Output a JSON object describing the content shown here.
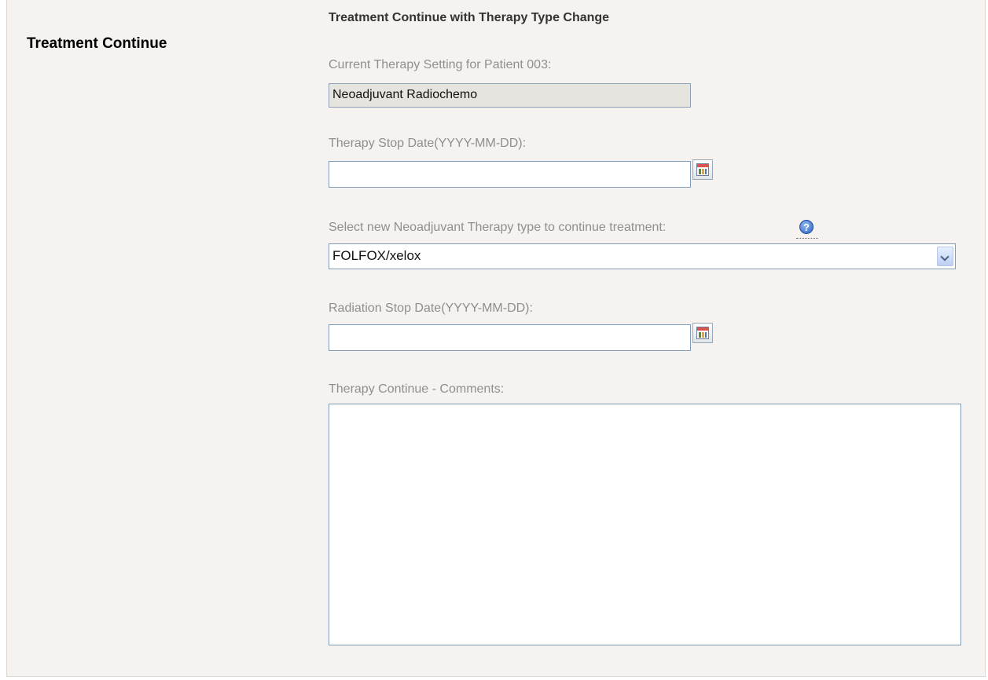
{
  "section": {
    "label": "Treatment Continue"
  },
  "form": {
    "title": "Treatment Continue with Therapy Type Change",
    "current_therapy": {
      "label": "Current Therapy Setting for Patient 003:",
      "value": "Neoadjuvant Radiochemo"
    },
    "therapy_stop_date": {
      "label": "Therapy Stop Date(YYYY-MM-DD):",
      "value": "",
      "calendar_icon": "calendar-icon"
    },
    "new_therapy_type": {
      "label": "Select new Neoadjuvant Therapy type to continue treatment:",
      "help_icon": "help-icon",
      "help_glyph": "?",
      "selected": "FOLFOX/xelox"
    },
    "radiation_stop_date": {
      "label": "Radiation Stop Date(YYYY-MM-DD):",
      "value": "",
      "calendar_icon": "calendar-icon"
    },
    "comments": {
      "label": "Therapy Continue - Comments:",
      "value": ""
    }
  },
  "colors": {
    "panel_background": "#f5f2ef",
    "label_gray": "#8f8f8f",
    "input_border": "#7f9db9",
    "readonly_background": "#e6e4df"
  }
}
